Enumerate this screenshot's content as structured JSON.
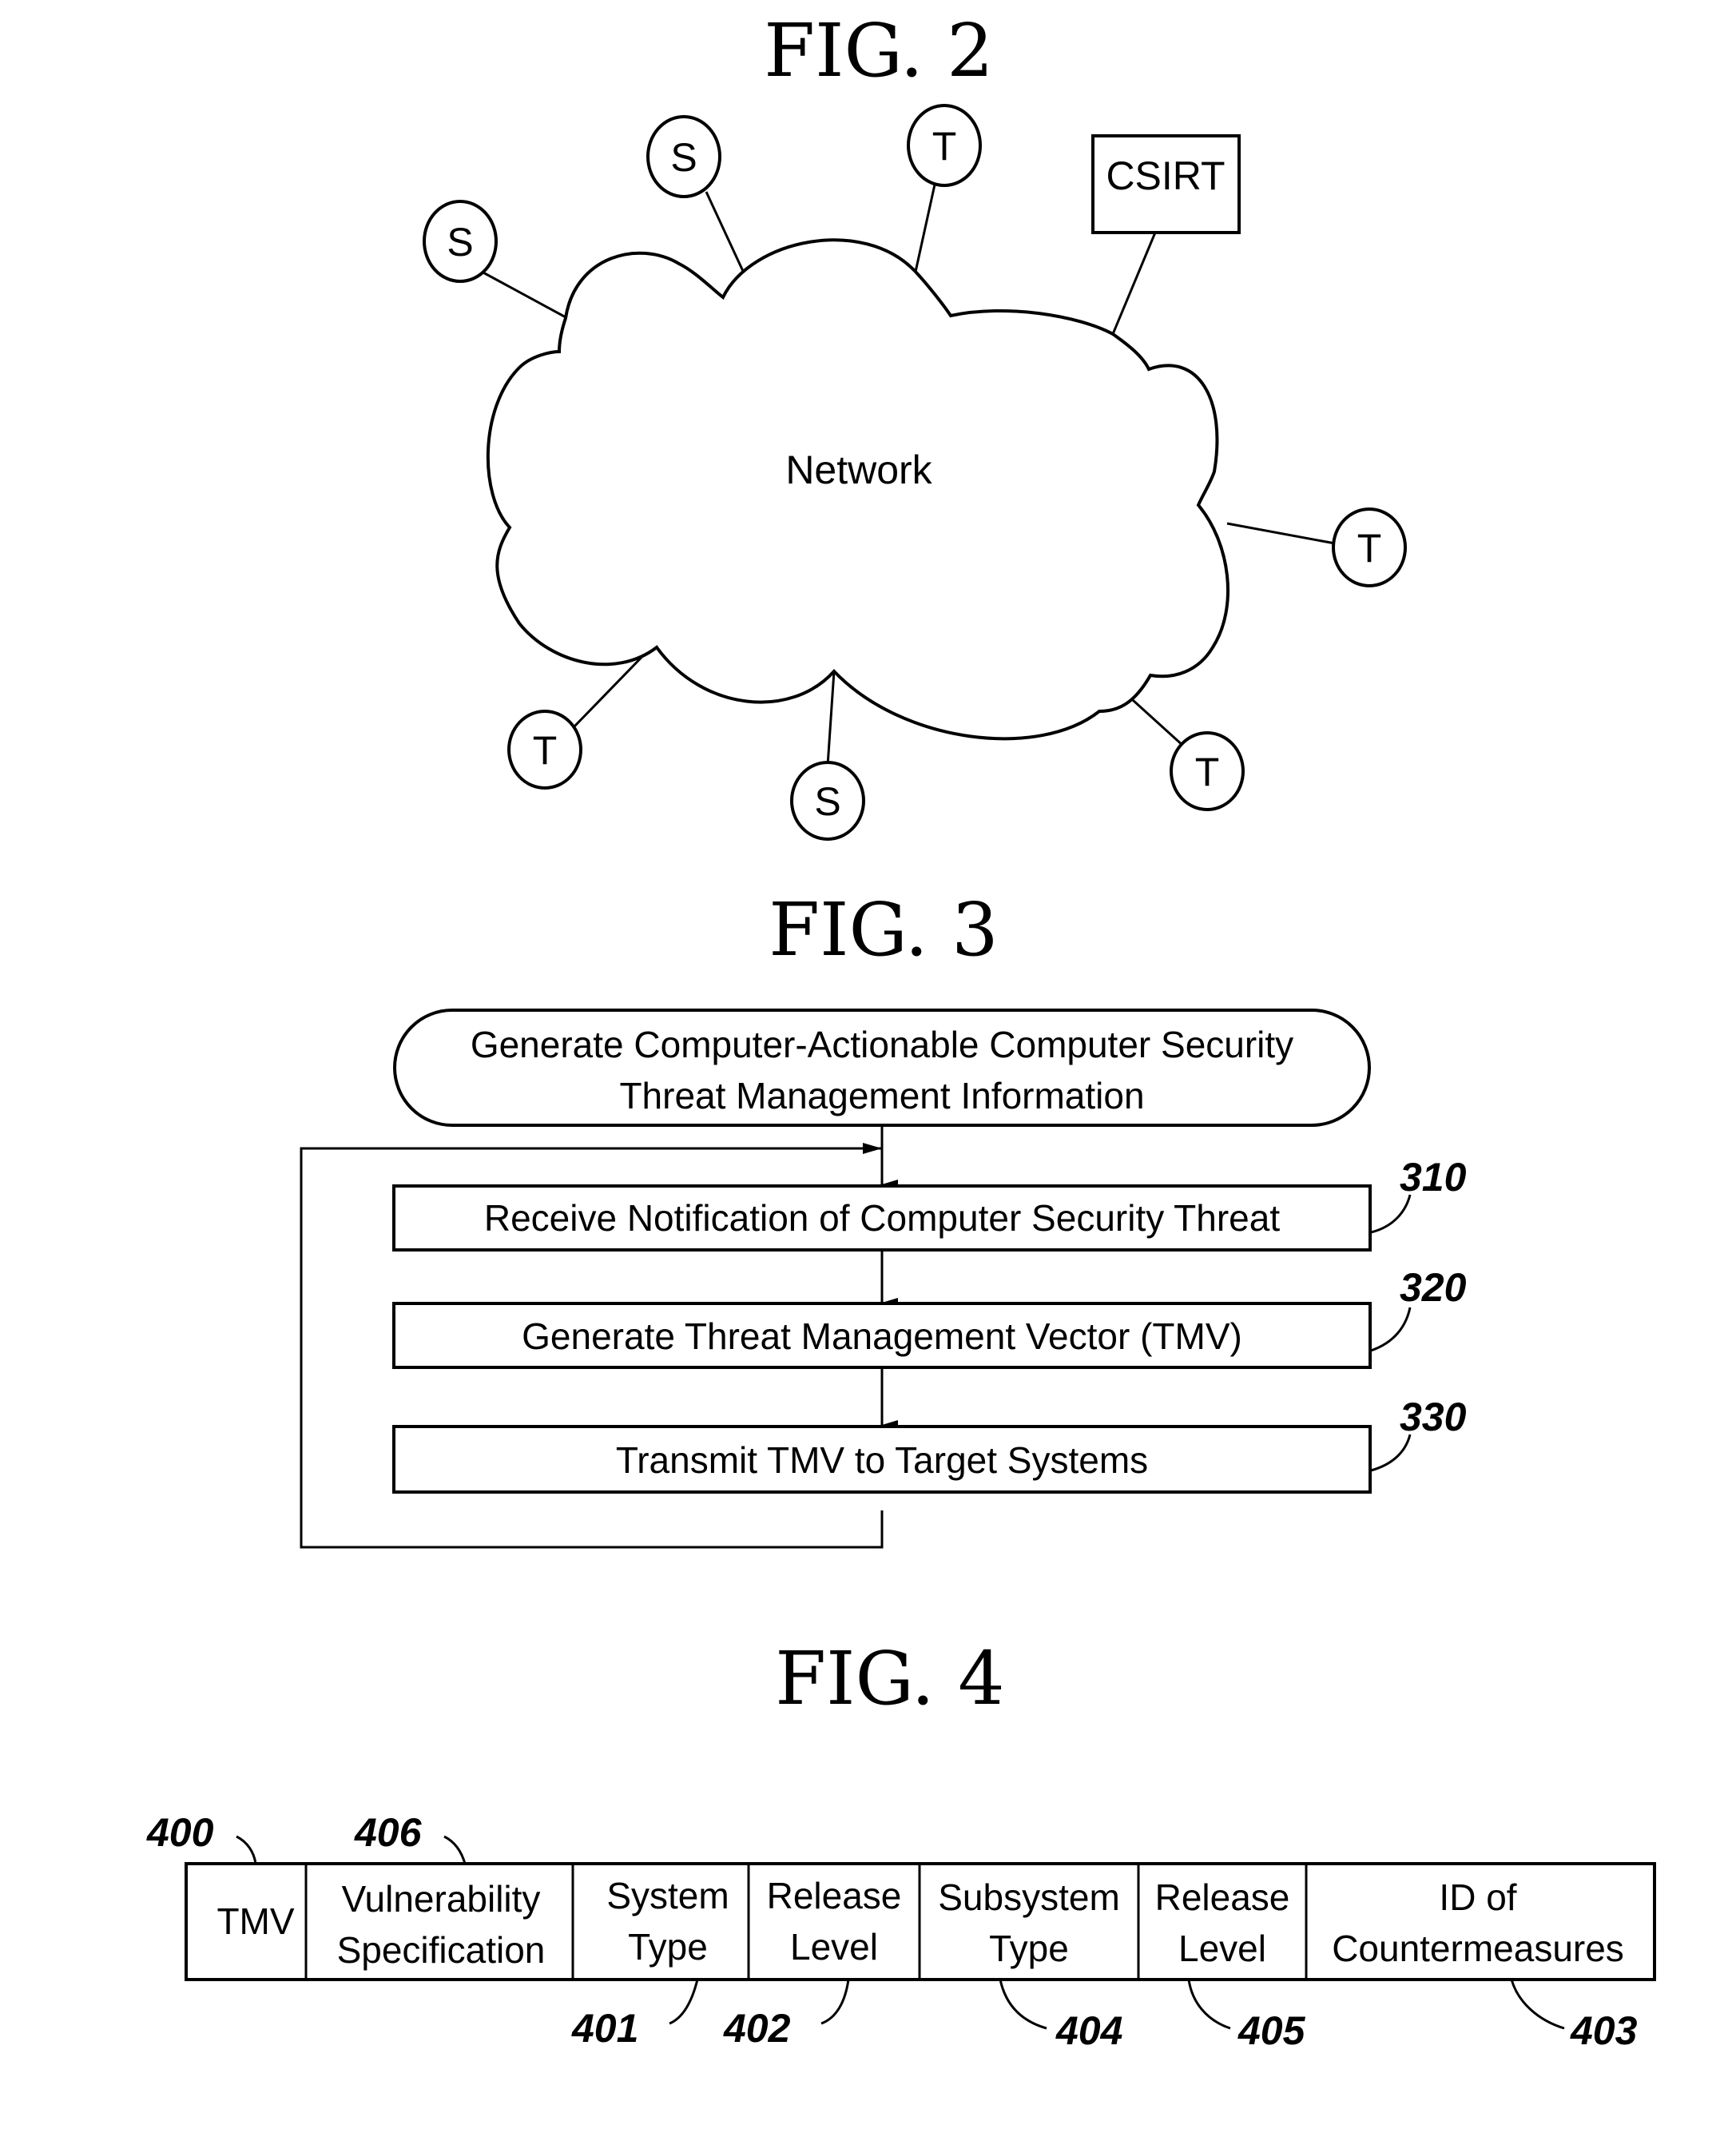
{
  "fig2": {
    "title": "FIG. 2",
    "cloud_label": "Network",
    "nodes": [
      {
        "id": "s1",
        "type": "circle",
        "label": "S"
      },
      {
        "id": "s2",
        "type": "circle",
        "label": "S"
      },
      {
        "id": "t1",
        "type": "circle",
        "label": "T"
      },
      {
        "id": "csirt",
        "type": "box",
        "label": "CSIRT"
      },
      {
        "id": "t2",
        "type": "circle",
        "label": "T"
      },
      {
        "id": "t3",
        "type": "circle",
        "label": "T"
      },
      {
        "id": "s3",
        "type": "circle",
        "label": "S"
      },
      {
        "id": "t4",
        "type": "circle",
        "label": "T"
      }
    ]
  },
  "fig3": {
    "title": "FIG. 3",
    "start": {
      "line1": "Generate Computer-Actionable Computer Security",
      "line2": "Threat Management Information"
    },
    "steps": [
      {
        "ref": "310",
        "label": "Receive Notification of Computer Security Threat"
      },
      {
        "ref": "320",
        "label": "Generate Threat Management Vector (TMV)"
      },
      {
        "ref": "330",
        "label": "Transmit TMV to Target Systems"
      }
    ]
  },
  "fig4": {
    "title": "FIG. 4",
    "refs_top": [
      {
        "ref": "400"
      },
      {
        "ref": "406"
      }
    ],
    "cells": [
      {
        "line1": "TMV",
        "line2": ""
      },
      {
        "line1": "Vulnerability",
        "line2": "Specification"
      },
      {
        "line1": "System",
        "line2": "Type"
      },
      {
        "line1": "Release",
        "line2": "Level"
      },
      {
        "line1": "Subsystem",
        "line2": "Type"
      },
      {
        "line1": "Release",
        "line2": "Level"
      },
      {
        "line1": "ID of",
        "line2": "Countermeasures"
      }
    ],
    "refs_bottom": [
      {
        "ref": "401"
      },
      {
        "ref": "402"
      },
      {
        "ref": "404"
      },
      {
        "ref": "405"
      },
      {
        "ref": "403"
      }
    ]
  }
}
